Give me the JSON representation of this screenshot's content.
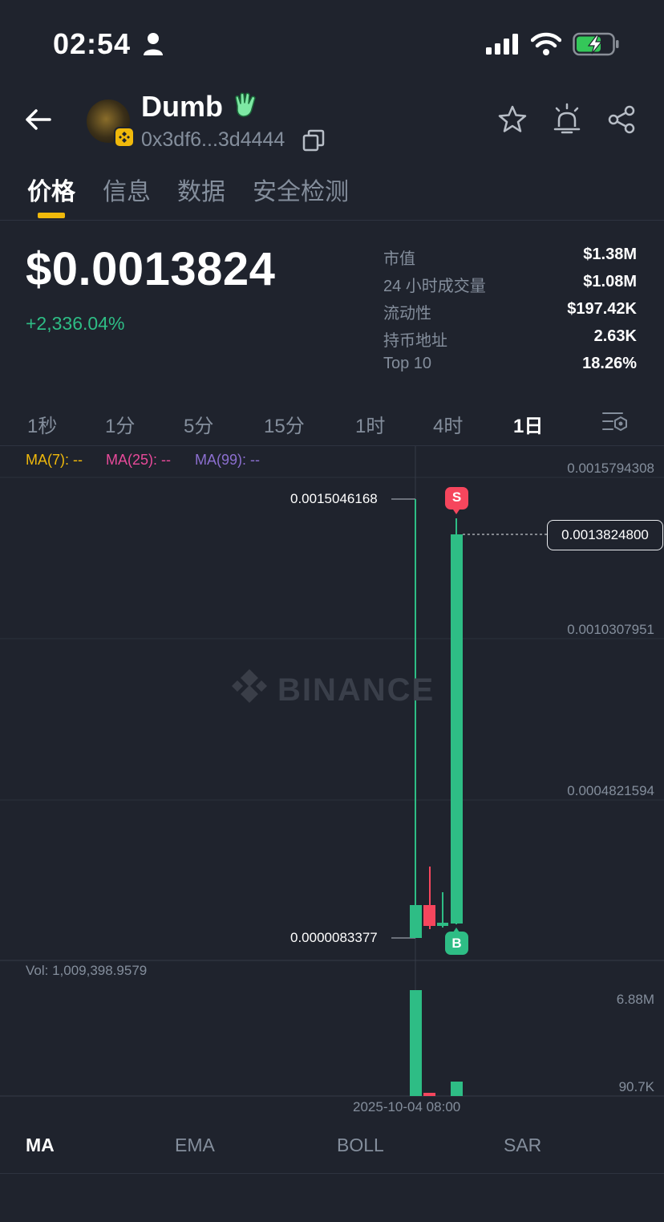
{
  "status_bar": {
    "time": "02:54"
  },
  "token": {
    "name": "Dumb",
    "address": "0x3df6...3d4444",
    "icons": [
      "back-arrow-icon",
      "person-icon",
      "hand-emoji-icon",
      "copy-icon",
      "star-icon",
      "alarm-icon",
      "share-icon"
    ]
  },
  "tabs": [
    "价格",
    "信息",
    "数据",
    "安全检测"
  ],
  "active_tab": "价格",
  "price": {
    "value": "$0.0013824",
    "change": "+2,336.04%"
  },
  "stats": [
    {
      "label": "市值",
      "value": "$1.38M"
    },
    {
      "label": "24 小时成交量",
      "value": "$1.08M"
    },
    {
      "label": "流动性",
      "value": "$197.42K"
    },
    {
      "label": "持币地址",
      "value": "2.63K"
    },
    {
      "label": "Top 10",
      "value": "18.26%"
    }
  ],
  "intervals": [
    "1秒",
    "1分",
    "5分",
    "15分",
    "1时",
    "4时",
    "1日"
  ],
  "active_interval": "1日",
  "ma_legend": [
    {
      "label": "MA(7): --",
      "color": "#f0b90b"
    },
    {
      "label": "MA(25): --",
      "color": "#e84a9a"
    },
    {
      "label": "MA(99): --",
      "color": "#8c6fd0"
    }
  ],
  "chart": {
    "y_axis_labels": [
      "0.0015794308",
      "0.0010307951",
      "0.0004821594"
    ],
    "current_price_tag": "0.0013824800",
    "high_mark": "0.0015046168",
    "low_mark": "0.0000083377",
    "sell_marker": "S",
    "buy_marker": "B",
    "watermark": "BINANCE",
    "volume_label": "Vol: 1,009,398.9579",
    "volume_axis_labels": [
      "6.88M",
      "90.7K"
    ],
    "date_label": "2025-10-04 08:00",
    "up_color": "#2ebd85",
    "down_color": "#f6465d"
  },
  "indicators": [
    "MA",
    "EMA",
    "BOLL",
    "SAR"
  ],
  "active_indicator": "MA"
}
